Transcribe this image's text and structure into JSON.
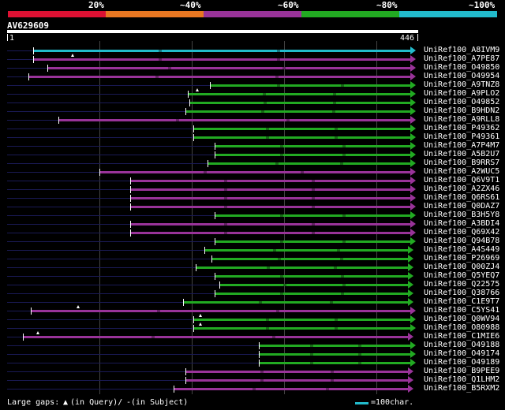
{
  "scale": {
    "labels": [
      "20%",
      "~40%",
      "~60%",
      "~80%",
      "~100%"
    ],
    "colors": [
      "#dd1133",
      "#e87722",
      "#993399",
      "#22aa22",
      "#22bbcc"
    ]
  },
  "query": {
    "name": "AV629609",
    "start": "1",
    "end": "446"
  },
  "hits": [
    {
      "name": "UniRef100_A8IVM9",
      "color": "cyan",
      "s": 42,
      "e": 525,
      "ins": []
    },
    {
      "name": "UniRef100_A7PE87",
      "color": "purple",
      "s": 42,
      "e": 525,
      "ins": [
        92
      ]
    },
    {
      "name": "UniRef100_O49850",
      "color": "purple",
      "s": 60,
      "e": 525,
      "ins": []
    },
    {
      "name": "UniRef100_O49954",
      "color": "purple",
      "s": 36,
      "e": 525,
      "ins": []
    },
    {
      "name": "UniRef100_A9TNZ8",
      "color": "green",
      "s": 266,
      "e": 525,
      "ins": []
    },
    {
      "name": "UniRef100_A9PLO2",
      "color": "green",
      "s": 238,
      "e": 525,
      "ins": [
        250
      ]
    },
    {
      "name": "UniRef100_O49852",
      "color": "green",
      "s": 240,
      "e": 525,
      "ins": []
    },
    {
      "name": "UniRef100_B9HDN2",
      "color": "green",
      "s": 235,
      "e": 525,
      "ins": []
    },
    {
      "name": "UniRef100_A9RLL8",
      "color": "purple",
      "s": 74,
      "e": 525,
      "ins": []
    },
    {
      "name": "UniRef100_P49362",
      "color": "green",
      "s": 245,
      "e": 525,
      "ins": []
    },
    {
      "name": "UniRef100_P49361",
      "color": "green",
      "s": 245,
      "e": 525,
      "ins": []
    },
    {
      "name": "UniRef100_A7P4M7",
      "color": "green",
      "s": 272,
      "e": 525,
      "ins": []
    },
    {
      "name": "UniRef100_A5B2U7",
      "color": "green",
      "s": 272,
      "e": 525,
      "ins": []
    },
    {
      "name": "UniRef100_B9RRS7",
      "color": "green",
      "s": 263,
      "e": 525,
      "ins": []
    },
    {
      "name": "UniRef100_A2WUC5",
      "color": "purple",
      "s": 126,
      "e": 525,
      "ins": []
    },
    {
      "name": "UniRef100_Q6V9T1",
      "color": "purple",
      "s": 165,
      "e": 525,
      "ins": []
    },
    {
      "name": "UniRef100_A2ZX46",
      "color": "purple",
      "s": 165,
      "e": 525,
      "ins": []
    },
    {
      "name": "UniRef100_Q6RS61",
      "color": "purple",
      "s": 165,
      "e": 525,
      "ins": []
    },
    {
      "name": "UniRef100_Q0DAZ7",
      "color": "purple",
      "s": 165,
      "e": 525,
      "ins": []
    },
    {
      "name": "UniRef100_B3H5Y8",
      "color": "green",
      "s": 272,
      "e": 525,
      "ins": []
    },
    {
      "name": "UniRef100_A3BDI4",
      "color": "purple",
      "s": 165,
      "e": 525,
      "ins": []
    },
    {
      "name": "UniRef100_Q69X42",
      "color": "purple",
      "s": 165,
      "e": 525,
      "ins": []
    },
    {
      "name": "UniRef100_Q94B78",
      "color": "green",
      "s": 272,
      "e": 525,
      "ins": []
    },
    {
      "name": "UniRef100_A4S449",
      "color": "green",
      "s": 259,
      "e": 522,
      "ins": []
    },
    {
      "name": "UniRef100_P26969",
      "color": "green",
      "s": 268,
      "e": 522,
      "ins": []
    },
    {
      "name": "UniRef100_Q00ZJ4",
      "color": "green",
      "s": 248,
      "e": 522,
      "ins": []
    },
    {
      "name": "UniRef100_Q5YEQ7",
      "color": "green",
      "s": 272,
      "e": 522,
      "ins": []
    },
    {
      "name": "UniRef100_Q22575",
      "color": "green",
      "s": 278,
      "e": 522,
      "ins": []
    },
    {
      "name": "UniRef100_Q38766",
      "color": "green",
      "s": 272,
      "e": 522,
      "ins": []
    },
    {
      "name": "UniRef100_C1E9T7",
      "color": "green",
      "s": 232,
      "e": 522,
      "ins": []
    },
    {
      "name": "UniRef100_C5YS41",
      "color": "purple",
      "s": 39,
      "e": 525,
      "ins": [
        99
      ]
    },
    {
      "name": "UniRef100_Q0WV94",
      "color": "green",
      "s": 245,
      "e": 525,
      "ins": [
        254
      ]
    },
    {
      "name": "UniRef100_O80988",
      "color": "green",
      "s": 245,
      "e": 525,
      "ins": [
        254
      ]
    },
    {
      "name": "UniRef100_C1MIE6",
      "color": "purple",
      "s": 29,
      "e": 522,
      "ins": [
        48
      ]
    },
    {
      "name": "UniRef100_O49188",
      "color": "green",
      "s": 328,
      "e": 525,
      "ins": []
    },
    {
      "name": "UniRef100_O49174",
      "color": "green",
      "s": 328,
      "e": 525,
      "ins": []
    },
    {
      "name": "UniRef100_O49189",
      "color": "green",
      "s": 328,
      "e": 525,
      "ins": []
    },
    {
      "name": "UniRef100_B9PEE9",
      "color": "purple",
      "s": 235,
      "e": 522,
      "ins": []
    },
    {
      "name": "UniRef100_Q1LHM2",
      "color": "purple",
      "s": 235,
      "e": 522,
      "ins": []
    },
    {
      "name": "UniRef100_B5RXM2",
      "color": "purple",
      "s": 220,
      "e": 522,
      "ins": []
    }
  ],
  "legend": {
    "gaps_text": "Large gaps:",
    "query_text": "(in Query)/",
    "subject_text": "(in Subject)",
    "scale_text": "=100char."
  }
}
